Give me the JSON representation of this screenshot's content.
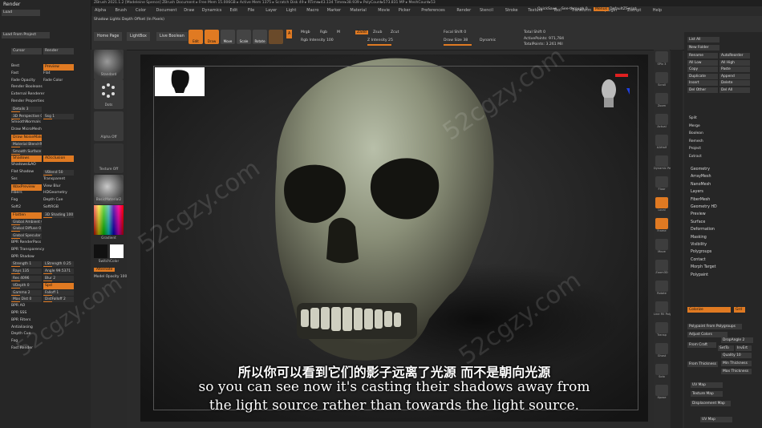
{
  "window": {
    "title": "ZBrush 2021.1.2 [Madeleine Spence] ZBrush Document  ▸ Free Mem 15.006GB ▸ Active Mem 1375 ▸ Scratch Disk 49 ▸ RTime▸43.134 Timer▸38.939 ▸ PolyCount▸573.831 MP ▸ MeshCount▸53",
    "quicksave": "QuickSave",
    "seethrough": "See-through  0",
    "menus": "Menus",
    "defaultscript": "DefaultZScript"
  },
  "menubar": [
    "Alpha",
    "Brush",
    "Color",
    "Document",
    "Draw",
    "Dynamics",
    "Edit",
    "File",
    "Layer",
    "Light",
    "Macro",
    "Marker",
    "Material",
    "Movie",
    "Picker",
    "Preferences",
    "Render",
    "Stencil",
    "Stroke",
    "Texture",
    "Tool",
    "Transform",
    "Zplugin",
    "Zscript",
    "Help"
  ],
  "toolbar": {
    "hint": "Shadow Lights Depth Offset (In Pixels)",
    "home_page": "Home Page",
    "lightbox": "LightBox",
    "live_boolean": "Live Boolean",
    "edit": "Edit",
    "draw": "Draw",
    "move": "Move",
    "scale": "Scale",
    "rotate": "Rotate",
    "a_btn": "A",
    "mrgb": "Mrgb",
    "rgb": "Rgb",
    "m": "M",
    "zadd": "Zadd",
    "zsub": "Zsub",
    "zcut": "Zcut",
    "rgb_intensity": "Rgb Intensity 100",
    "z_intensity": "Z Intensity 25",
    "focal_shift": "Focal Shift 0",
    "draw_size": "Draw Size 38",
    "dynamic": "Dynamic",
    "total_shift": "Total Shift 0",
    "active_points": "ActivePoints: 971,784",
    "total_points": "TotalPoints: 3.261 Mil"
  },
  "left_panel": {
    "title": "Render",
    "tabs": [
      "Cursor",
      "Render"
    ],
    "items": [
      {
        "label": "Best",
        "kind": "text"
      },
      {
        "label": "Preview",
        "kind": "orange"
      },
      {
        "label": "Fast",
        "kind": "text"
      },
      {
        "label": "Flat",
        "kind": "text"
      },
      {
        "label": "Fade Opacity",
        "kind": "text"
      },
      {
        "label": "Fade Color",
        "kind": "text"
      },
      {
        "label": "Render Booleans",
        "kind": "text"
      },
      {
        "label": "External Renderer",
        "kind": "text"
      },
      {
        "label": "Render Properties",
        "kind": "text"
      },
      {
        "label": "Details 3",
        "kind": "slider"
      },
      {
        "label": "3D Perspective 0",
        "kind": "slider"
      },
      {
        "label": "Ssg 1",
        "kind": "slider"
      },
      {
        "label": "SmoothNormals",
        "kind": "text"
      },
      {
        "label": "Draw MicroMesh",
        "kind": "text"
      },
      {
        "label": "Draw NoiseMaker3D",
        "kind": "orange"
      },
      {
        "label": "Material Blend-Radius 8",
        "kind": "slider"
      },
      {
        "label": "Smooth Surface Edges 0",
        "kind": "slider"
      },
      {
        "label": "Shadows",
        "kind": "orange"
      },
      {
        "label": "AOcclusion",
        "kind": "orange"
      },
      {
        "label": "Shadows&AO",
        "kind": "text"
      },
      {
        "label": "Flat Shadow",
        "kind": "text"
      },
      {
        "label": "VBlend 50",
        "kind": "slider"
      },
      {
        "label": "Sss",
        "kind": "text"
      },
      {
        "label": "Transparent",
        "kind": "text"
      },
      {
        "label": "WaxPreview",
        "kind": "orange"
      },
      {
        "label": "View Blur",
        "kind": "text"
      },
      {
        "label": "Fibers",
        "kind": "text"
      },
      {
        "label": "HDGeometry",
        "kind": "text"
      },
      {
        "label": "Fog",
        "kind": "text"
      },
      {
        "label": "Depth Cue",
        "kind": "text"
      },
      {
        "label": "Soft2",
        "kind": "text"
      },
      {
        "label": "SoftRGB",
        "kind": "text"
      },
      {
        "label": "Flatten",
        "kind": "orange"
      },
      {
        "label": "3D Shading 100",
        "kind": "slider"
      },
      {
        "label": "Global Ambient 0",
        "kind": "slider"
      },
      {
        "label": "Global Diffuse 0",
        "kind": "slider"
      },
      {
        "label": "Global Specular 0",
        "kind": "slider"
      },
      {
        "label": "BPR RenderPass",
        "kind": "text"
      },
      {
        "label": "BPR Transparency",
        "kind": "text"
      },
      {
        "label": "BPR Shadow",
        "kind": "text"
      },
      {
        "label": "Strength 1",
        "kind": "slider"
      },
      {
        "label": "LStrength 0.25",
        "kind": "slider"
      },
      {
        "label": "Rays 135",
        "kind": "slider"
      },
      {
        "label": "Angle 99.5371",
        "kind": "slider"
      },
      {
        "label": "Res 4096",
        "kind": "slider"
      },
      {
        "label": "Blur 2",
        "kind": "slider"
      },
      {
        "label": "VDepth 0",
        "kind": "slider"
      },
      {
        "label": "LDepth 0",
        "kind": "slider"
      },
      {
        "label": "Spd",
        "kind": "orange"
      },
      {
        "label": "Gamma 2",
        "kind": "slider"
      },
      {
        "label": "Falloff 1",
        "kind": "slider"
      },
      {
        "label": "Max Dist 0",
        "kind": "slider"
      },
      {
        "label": "DistFalloff 2",
        "kind": "slider"
      },
      {
        "label": "BPR AO",
        "kind": "text"
      },
      {
        "label": "BPR SSS",
        "kind": "text"
      },
      {
        "label": "BPR Filters",
        "kind": "text"
      },
      {
        "label": "Antialiasing",
        "kind": "text"
      },
      {
        "label": "Depth Cue",
        "kind": "text"
      },
      {
        "label": "Fog",
        "kind": "text"
      },
      {
        "label": "Fast Render",
        "kind": "text"
      }
    ]
  },
  "brush_column": {
    "standard": "Standard",
    "dots": "Dots",
    "alpha_off": "Alpha Off",
    "texture_off": "Texture Off",
    "material": "BasicMaterial2",
    "gradient": "Gradient",
    "switch_color": "SwitchColor",
    "alternate": "Alternate",
    "model_opacity": "Model Opacity 100"
  },
  "right_strip": [
    "SPix 3",
    "Scroll",
    "Zoom",
    "Actual",
    "AAHalf",
    "Dynamic Persp",
    "Floor",
    "Local",
    "Frame",
    "Move",
    "Zoom3D",
    "Rotate",
    "Line Fill PolyF",
    "Transp",
    "Ghost",
    "Solo",
    "Xpose"
  ],
  "right_panel": {
    "top_buttons": [
      "List All",
      "New Folder",
      "Rename",
      "AutoReorder",
      "All Low",
      "All High",
      "Copy",
      "Paste",
      "Duplicate",
      "Append",
      "Insert",
      "Delete",
      "Del Other",
      "Del All",
      "Split",
      "Merge",
      "Boolean",
      "Remesh",
      "Project",
      "Extract"
    ],
    "sections": [
      "Geometry",
      "ArrayMesh",
      "NanoMesh",
      "Layers",
      "FiberMesh",
      "Geometry HD",
      "Preview",
      "Surface",
      "Deformation",
      "Masking",
      "Visibility",
      "Polygroups",
      "Contact",
      "Morph Target",
      "Polypaint"
    ],
    "colorize": "Colorize",
    "grd": "Grd",
    "polypaint_from_polygroups": "Polypaint From Polygroups",
    "adjust_colors": "Adjust Colors",
    "from_craft": "From Craft",
    "drop_angle": "DropAngle 2",
    "set_to": "SetTo",
    "invert": "InvErt",
    "quality": "Quality 10",
    "min_thickness": "Min Thickness",
    "from_thickness": "From Thickness",
    "max_thickness": "Max Thickness",
    "uv_map": "UV Map",
    "texture_map": "Texture Map",
    "displacement_map": "Displacement Map",
    "uv_map2": "UV Map"
  },
  "subtitles": {
    "zh": "所以你可以看到它们的影子远离了光源  而不是朝向光源",
    "en_line1": "so you can see now it's casting their shadows away from",
    "en_line2": "the light source rather than towards the light source."
  },
  "watermark": "52cgzy.com",
  "colors": {
    "accent": "#e07a22",
    "panel": "#262626",
    "viewport": "#222222"
  }
}
